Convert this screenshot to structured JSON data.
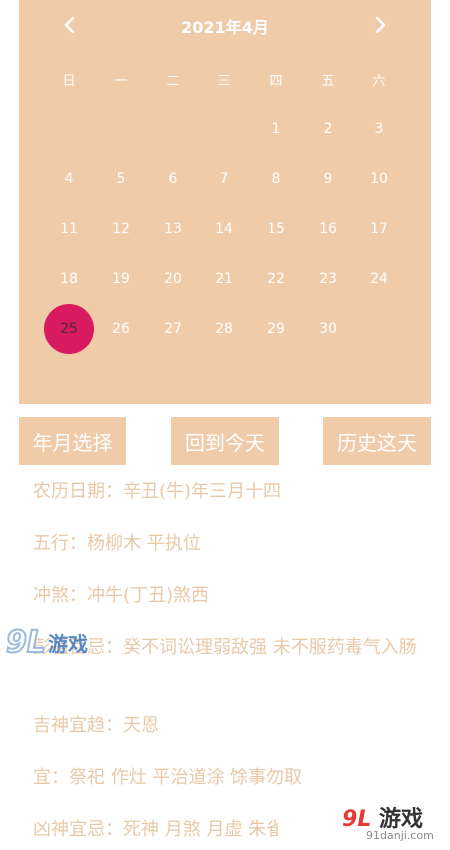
{
  "calendar": {
    "title": "2021年4月",
    "prev_icon": "chevron-left-icon",
    "next_icon": "chevron-right-icon",
    "weekdays": [
      "日",
      "一",
      "二",
      "三",
      "四",
      "五",
      "六"
    ],
    "weeks": [
      [
        "",
        "",
        "",
        "",
        "1",
        "2",
        "3"
      ],
      [
        "4",
        "5",
        "6",
        "7",
        "8",
        "9",
        "10"
      ],
      [
        "11",
        "12",
        "13",
        "14",
        "15",
        "16",
        "17"
      ],
      [
        "18",
        "19",
        "20",
        "21",
        "22",
        "23",
        "24"
      ],
      [
        "25",
        "26",
        "27",
        "28",
        "29",
        "30",
        ""
      ]
    ],
    "selected": "25",
    "colors": {
      "background": "#efcba9",
      "selected": "#d81b60",
      "text": "#ffffff"
    }
  },
  "buttons": {
    "year_month": "年月选择",
    "today": "回到今天",
    "history": "历史这天"
  },
  "info": [
    {
      "label": "农历日期：",
      "value": "辛丑(牛)年三月十四"
    },
    {
      "label": "五行：",
      "value": "杨柳木 平执位"
    },
    {
      "label": "冲煞：",
      "value": "冲牛(丁丑)煞西"
    },
    {
      "label": "彭祖百忌：",
      "value": "癸不词讼理弱敌强 未不服药毒气入肠"
    },
    {
      "label": "吉神宜趋：",
      "value": "天恩"
    },
    {
      "label": "宜：",
      "value": "祭祀 作灶 平治道涂 馀事勿取"
    },
    {
      "label": "凶神宜忌：",
      "value": "死神 月煞 月虚 朱雀"
    }
  ],
  "watermarks": {
    "top_left": {
      "num": "9",
      "text": "游戏"
    },
    "bottom_right": {
      "num": "9",
      "text": "游戏",
      "url": "91danji.com"
    }
  }
}
